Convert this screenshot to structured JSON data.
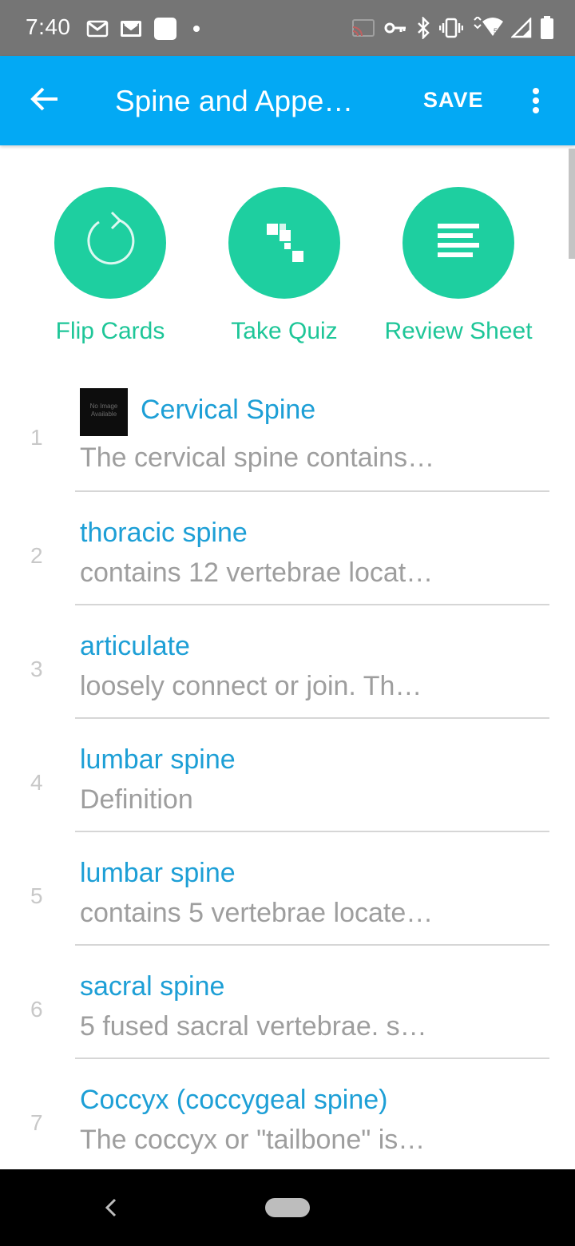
{
  "status_bar": {
    "time": "7:40",
    "left_icons": [
      "gmail-icon",
      "gmail-icon",
      "app-square-icon",
      "dot-icon"
    ],
    "right_icons": [
      "cast-icon",
      "vpn-key-icon",
      "bluetooth-icon",
      "vibrate-icon",
      "wifi-icon",
      "signal-icon",
      "battery-icon"
    ]
  },
  "app_bar": {
    "title": "Spine and Appe…",
    "save_label": "SAVE",
    "color": "#03a9f4"
  },
  "actions": [
    {
      "label": "Flip Cards",
      "icon": "refresh-icon"
    },
    {
      "label": "Take Quiz",
      "icon": "quiz-grid-icon"
    },
    {
      "label": "Review Sheet",
      "icon": "review-lines-icon"
    }
  ],
  "accent_color": "#1ecfa0",
  "thumb_text": "No Image Available",
  "cards": [
    {
      "num": "1",
      "term": "Cervical Spine",
      "definition": "The cervical spine contains…",
      "has_image": true
    },
    {
      "num": "2",
      "term": "thoracic spine",
      "definition": "contains 12 vertebrae locat…"
    },
    {
      "num": "3",
      "term": "articulate",
      "definition": "loosely connect or join. Th…"
    },
    {
      "num": "4",
      "term": "lumbar spine",
      "definition": "Definition"
    },
    {
      "num": "5",
      "term": "lumbar spine",
      "definition": "contains 5 vertebrae locate…"
    },
    {
      "num": "6",
      "term": "sacral spine",
      "definition": "5 fused sacral vertebrae. s…"
    },
    {
      "num": "7",
      "term": "Coccyx (coccygeal spine)",
      "definition": "The coccyx or \"tailbone\" is…"
    }
  ]
}
